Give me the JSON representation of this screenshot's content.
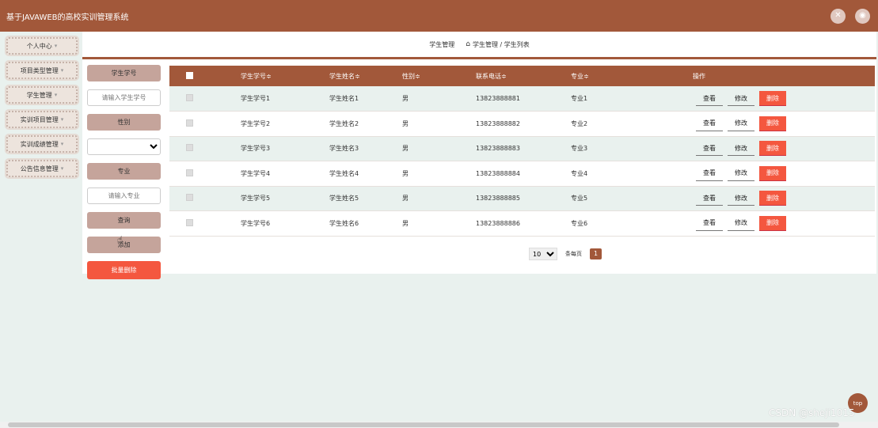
{
  "header": {
    "title": "基于JAVAWEB的高校实训管理系统",
    "fullscreen_icon": "fullscreen-icon",
    "user_icon": "user-icon"
  },
  "sidebar": {
    "items": [
      {
        "label": "个人中心"
      },
      {
        "label": "项目类型管理"
      },
      {
        "label": "学生管理"
      },
      {
        "label": "实训项目管理"
      },
      {
        "label": "实训成绩管理"
      },
      {
        "label": "公告信息管理"
      }
    ]
  },
  "breadcrumb": {
    "title": "学生管理",
    "path": "学生管理 / 学生列表"
  },
  "filters": {
    "student_no_label": "学生学号",
    "student_no_placeholder": "请输入学生学号",
    "gender_label": "性别",
    "major_label": "专业",
    "major_placeholder": "请输入专业",
    "search_label": "查询",
    "add_label": "添加",
    "batch_delete_label": "批量删除"
  },
  "table": {
    "headers": [
      "学生学号",
      "学生姓名",
      "性别",
      "联系电话",
      "专业",
      "操作"
    ],
    "sort_mark": "≑",
    "rows": [
      {
        "no": "学生学号1",
        "name": "学生姓名1",
        "gender": "男",
        "phone": "13823888881",
        "major": "专业1"
      },
      {
        "no": "学生学号2",
        "name": "学生姓名2",
        "gender": "男",
        "phone": "13823888882",
        "major": "专业2"
      },
      {
        "no": "学生学号3",
        "name": "学生姓名3",
        "gender": "男",
        "phone": "13823888883",
        "major": "专业3"
      },
      {
        "no": "学生学号4",
        "name": "学生姓名4",
        "gender": "男",
        "phone": "13823888884",
        "major": "专业4"
      },
      {
        "no": "学生学号5",
        "name": "学生姓名5",
        "gender": "男",
        "phone": "13823888885",
        "major": "专业5"
      },
      {
        "no": "学生学号6",
        "name": "学生姓名6",
        "gender": "男",
        "phone": "13823888886",
        "major": "专业6"
      }
    ],
    "actions": {
      "view": "查看",
      "edit": "修改",
      "delete": "删除"
    }
  },
  "pager": {
    "page_size": "10",
    "page_size_label": "条每页",
    "current_page": "1"
  },
  "top_button": "top",
  "watermark": "CSDN @sheji1015",
  "colors": {
    "accent": "#a2583a",
    "danger": "#f4573f",
    "label": "#c5a49b"
  }
}
